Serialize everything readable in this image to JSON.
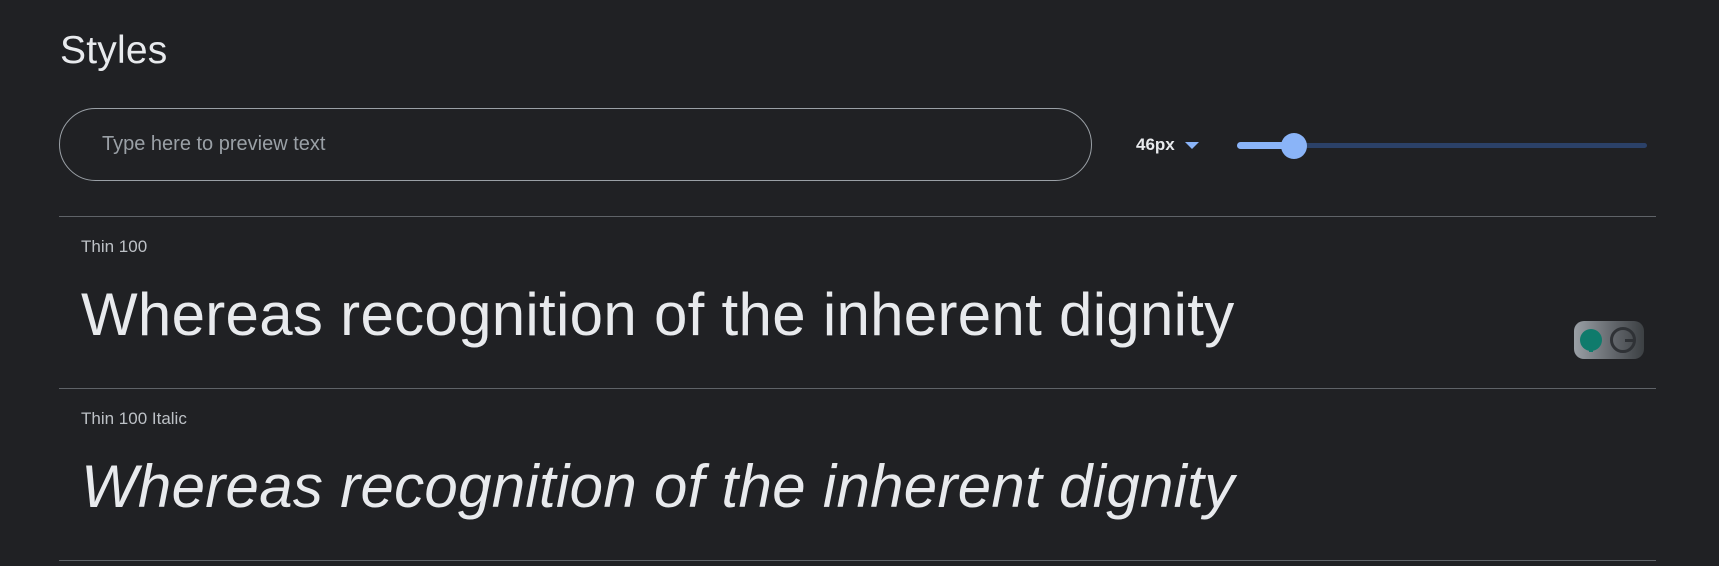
{
  "header": {
    "title": "Styles"
  },
  "preview": {
    "placeholder": "Type here to preview text",
    "value": ""
  },
  "size_control": {
    "selected": "46px",
    "slider_fraction": 0.14
  },
  "styles": [
    {
      "label": "Thin 100",
      "sample": "Whereas recognition of the inherent dignity"
    },
    {
      "label": "Thin 100 Italic",
      "sample": "Whereas recognition of the inherent dignity"
    }
  ],
  "icons": {
    "size_dropdown": "chevron-down-icon",
    "extension": "grammarly-icon"
  },
  "colors": {
    "background": "#202124",
    "accent": "#8ab4f8",
    "track": "#2b4168",
    "text": "#e8eaed",
    "muted_text": "#bdc1c6",
    "divider": "#5f6368"
  }
}
